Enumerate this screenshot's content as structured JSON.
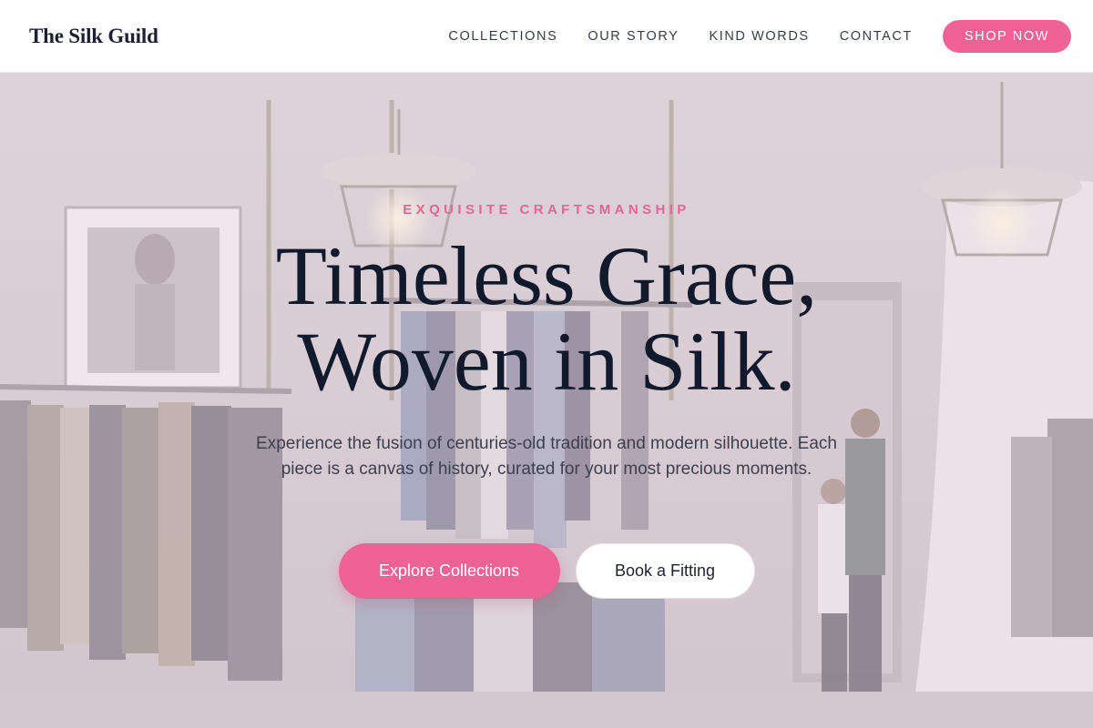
{
  "header": {
    "brand": "The Silk Guild",
    "nav": [
      {
        "label": "COLLECTIONS"
      },
      {
        "label": "OUR STORY"
      },
      {
        "label": "KIND WORDS"
      },
      {
        "label": "CONTACT"
      }
    ],
    "shop_label": "SHOP NOW"
  },
  "hero": {
    "eyebrow": "EXQUISITE CRAFTSMANSHIP",
    "headline_line1": "Timeless Grace,",
    "headline_line2": "Woven in Silk.",
    "subtext": "Experience the fusion of centuries-old tradition and modern silhouette. Each piece is a canvas of history, curated for your most precious moments.",
    "primary_cta": "Explore Collections",
    "secondary_cta": "Book a Fitting"
  },
  "colors": {
    "accent": "#ef6394",
    "heading": "#111a2c",
    "body_text": "#3c3f4f"
  }
}
